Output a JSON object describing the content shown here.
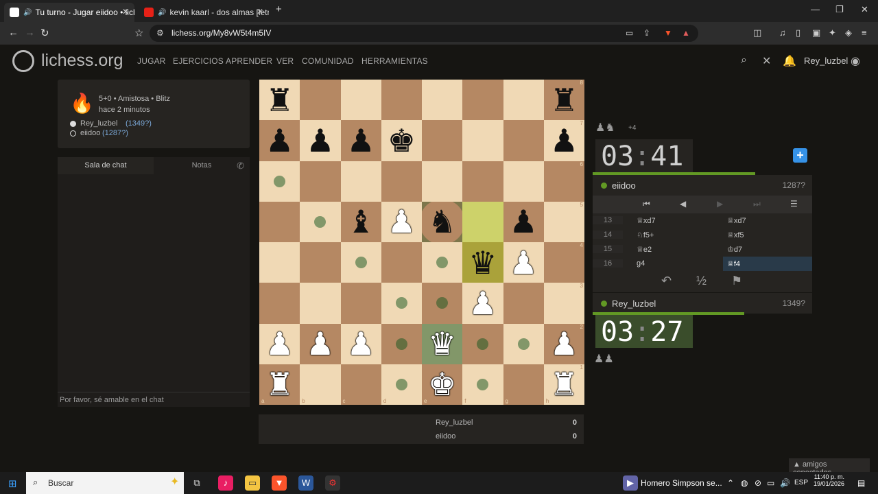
{
  "browser": {
    "tabs": [
      {
        "title": "Tu turno - Jugar eiidoo • lich",
        "active": true
      },
      {
        "title": "kevin kaarl - dos almas [letra] - Yo",
        "active": false
      }
    ],
    "new_tab": "+",
    "url": "lichess.org/My8vW5t4m5IV",
    "window_controls": {
      "minimize": "—",
      "maximize": "❐",
      "close": "✕"
    }
  },
  "site": {
    "logo": "lichess.org",
    "nav": [
      "JUGAR",
      "EJERCICIOS",
      "APRENDER",
      "VER",
      "COMUNIDAD",
      "HERRAMIENTAS"
    ],
    "user": "Rey_luzbel"
  },
  "game_info": {
    "mode": "5+0 • Amistosa • Blitz",
    "time_ago": "hace 2 minutos",
    "white_player": "Rey_luzbel",
    "white_rating": "(1349?)",
    "black_player": "eiidoo",
    "black_rating": "(1287?)"
  },
  "chat": {
    "tabs": [
      "Sala de chat",
      "Notas"
    ],
    "placeholder": "Por favor, sé amable en el chat"
  },
  "board": {
    "rows": [
      [
        {
          "p": "♜",
          "c": "b"
        },
        {},
        {},
        {},
        {},
        {},
        {},
        {
          "p": "♜",
          "c": "b"
        }
      ],
      [
        {
          "p": "♟",
          "c": "b"
        },
        {
          "p": "♟",
          "c": "b"
        },
        {
          "p": "♟",
          "c": "b"
        },
        {
          "p": "♚",
          "c": "b"
        },
        {},
        {},
        {},
        {
          "p": "♟",
          "c": "b"
        }
      ],
      [
        {
          "dot": true
        },
        {},
        {},
        {},
        {},
        {},
        {},
        {}
      ],
      [
        {},
        {
          "dot": true
        },
        {
          "p": "♝",
          "c": "b"
        },
        {
          "p": "♟",
          "c": "w"
        },
        {
          "p": "♞",
          "c": "b",
          "cap": true
        },
        {
          "hl": true
        },
        {
          "p": "♟",
          "c": "b"
        },
        {}
      ],
      [
        {},
        {},
        {
          "dot": true
        },
        {},
        {
          "dot": true
        },
        {
          "p": "♛",
          "c": "b",
          "hl": true
        },
        {
          "p": "♟",
          "c": "w"
        },
        {}
      ],
      [
        {},
        {},
        {},
        {
          "dot": true
        },
        {
          "dot": true
        },
        {
          "p": "♟",
          "c": "w"
        },
        {},
        {}
      ],
      [
        {
          "p": "♟",
          "c": "w"
        },
        {
          "p": "♟",
          "c": "w"
        },
        {
          "p": "♟",
          "c": "w"
        },
        {
          "dot": true
        },
        {
          "p": "♛",
          "c": "w",
          "sel": true
        },
        {
          "dot": true
        },
        {
          "dot": true
        },
        {
          "p": "♟",
          "c": "w"
        }
      ],
      [
        {
          "p": "♜",
          "c": "w"
        },
        {},
        {},
        {
          "dot": true
        },
        {
          "p": "♚",
          "c": "w"
        },
        {
          "dot": true
        },
        {},
        {
          "p": "♜",
          "c": "w"
        }
      ]
    ],
    "files": [
      "a",
      "b",
      "c",
      "d",
      "e",
      "f",
      "g",
      "h"
    ],
    "ranks": [
      "8",
      "7",
      "6",
      "5",
      "4",
      "3",
      "2",
      "1"
    ]
  },
  "opponent": {
    "material": "♟♞",
    "material_diff": "+4",
    "clock_min": "03",
    "clock_sec": "41",
    "time_fraction": 0.74,
    "name": "eiidoo",
    "rating": "1287?"
  },
  "player": {
    "material": "♟♟",
    "clock_min": "03",
    "clock_sec": "27",
    "time_fraction": 0.69,
    "name": "Rey_luzbel",
    "rating": "1349?"
  },
  "move_controls": [
    "⏮",
    "◀",
    "▶",
    "⏭",
    "☰"
  ],
  "moves": [
    {
      "num": "13",
      "white": "♕xd7",
      "black": "♕xd7"
    },
    {
      "num": "14",
      "white": "♘f5+",
      "black": "♕xf5"
    },
    {
      "num": "15",
      "white": "♕e2",
      "black": "♔d7"
    },
    {
      "num": "16",
      "white": "g4",
      "black": "♕f4"
    }
  ],
  "actions": {
    "takeback": "↶",
    "draw": "½",
    "resign": "⚑"
  },
  "under_board": {
    "rows": [
      {
        "name": "Rey_luzbel",
        "score": "0"
      },
      {
        "name": "eiidoo",
        "score": "0"
      }
    ]
  },
  "friends": "▲ amigos conectados",
  "taskbar": {
    "search": "Buscar",
    "media": "Homero Simpson se...",
    "lang": "ESP",
    "time": "11:40 p. m.",
    "date": "19/01/2026"
  },
  "colors": {
    "light_square": "#f0d9b5",
    "dark_square": "#b58863",
    "accent_green": "#629924",
    "clock_running": "#3a4d2b"
  }
}
